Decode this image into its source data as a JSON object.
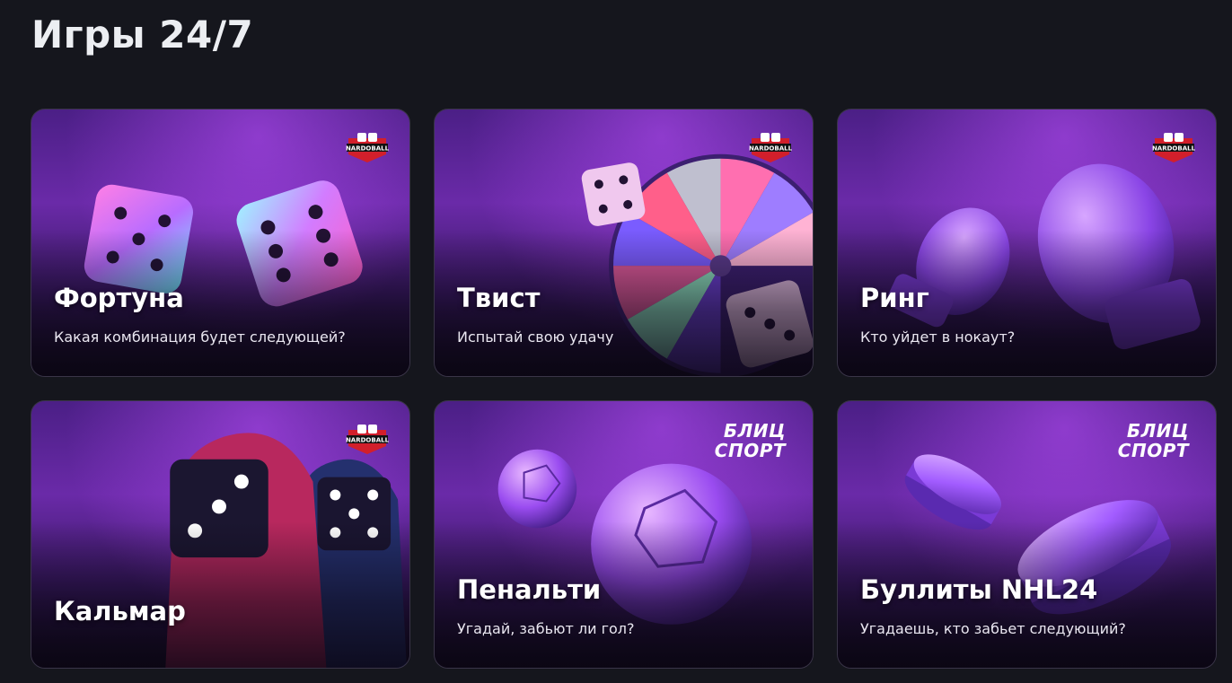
{
  "page": {
    "title": "Игры 24/7"
  },
  "brands": {
    "nardoball": "NARDOBALL",
    "blitz_line1": "БЛИЦ",
    "blitz_line2": "СПОРТ"
  },
  "games": [
    {
      "name": "Фортуна",
      "description": "Какая комбинация будет следующей?",
      "brand": "nardoball",
      "art": "dice-pair"
    },
    {
      "name": "Твист",
      "description": "Испытай свою удачу",
      "brand": "nardoball",
      "art": "fortune-wheel"
    },
    {
      "name": "Ринг",
      "description": "Кто уйдет в нокаут?",
      "brand": "nardoball",
      "art": "boxing-gloves"
    },
    {
      "name": "Кальмар",
      "description": "",
      "brand": "nardoball",
      "art": "squid-figures"
    },
    {
      "name": "Пенальти",
      "description": "Угадай, забьют ли гол?",
      "brand": "blitz-sport",
      "art": "soccer-balls"
    },
    {
      "name": "Буллиты NHL24",
      "description": "Угадаешь, кто забьет следующий?",
      "brand": "blitz-sport",
      "art": "hockey-pucks"
    }
  ],
  "colors": {
    "background": "#15161d",
    "card_purple": "#6a2aa8",
    "accent_pink": "#ff4fb3",
    "nardoball_red": "#d21f2b"
  }
}
